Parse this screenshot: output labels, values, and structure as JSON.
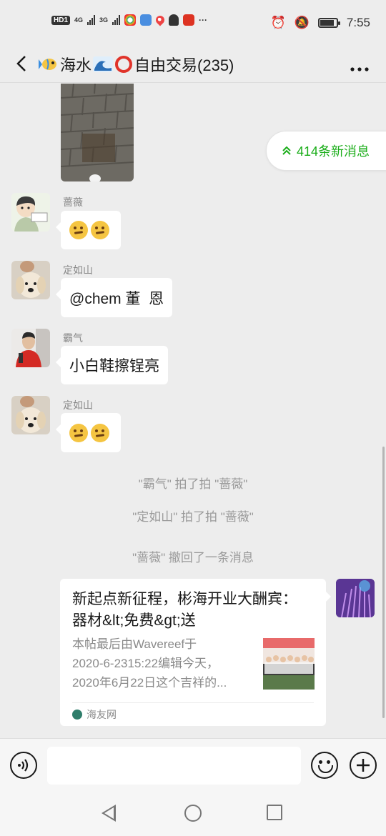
{
  "status_bar": {
    "network_hd": "HD",
    "network_hd_sub": "1",
    "net1": "4G",
    "net2": "3G",
    "time": "7:55",
    "icons": [
      "alarm-icon",
      "mute-icon",
      "battery-icon"
    ]
  },
  "header": {
    "title": "海水",
    "title_rest": "自由交易(235)",
    "back_icon": "chevron-left-icon",
    "more_icon": "more-icon"
  },
  "new_messages_pill": {
    "label": "414条新消息",
    "icon": "double-chevron-up-icon"
  },
  "messages": [
    {
      "sender": "蔷薇",
      "type": "emoji",
      "emoji": [
        "thinking-face",
        "thinking-face"
      ]
    },
    {
      "sender": "定如山",
      "type": "text",
      "text": "@chem 董  恩"
    },
    {
      "sender": "霸气",
      "type": "text",
      "text": "小白鞋擦锃亮"
    },
    {
      "sender": "定如山",
      "type": "emoji",
      "emoji": [
        "thinking-face",
        "thinking-face"
      ]
    }
  ],
  "system_messages": [
    "\"霸气\" 拍了拍 \"蔷薇\"",
    "\"定如山\" 拍了拍 \"蔷薇\"",
    "\"蔷薇\" 撤回了一条消息"
  ],
  "link_card": {
    "title": "新起点新征程，彬海开业大酬宾：器材&lt;免费&gt;送",
    "desc_line1": "本帖最后由Wavereef于",
    "desc_line2": "2020-6-2315:22编辑今天，",
    "desc_line3": "2020年6月22日这个吉祥的...",
    "source": "海友网"
  },
  "input_bar": {
    "placeholder": "",
    "voice_icon": "voice-icon",
    "emoji_icon": "emoji-icon",
    "plus_icon": "plus-icon"
  },
  "colors": {
    "accent_green": "#1aad19",
    "background": "#ededed",
    "bubble": "#ffffff"
  }
}
